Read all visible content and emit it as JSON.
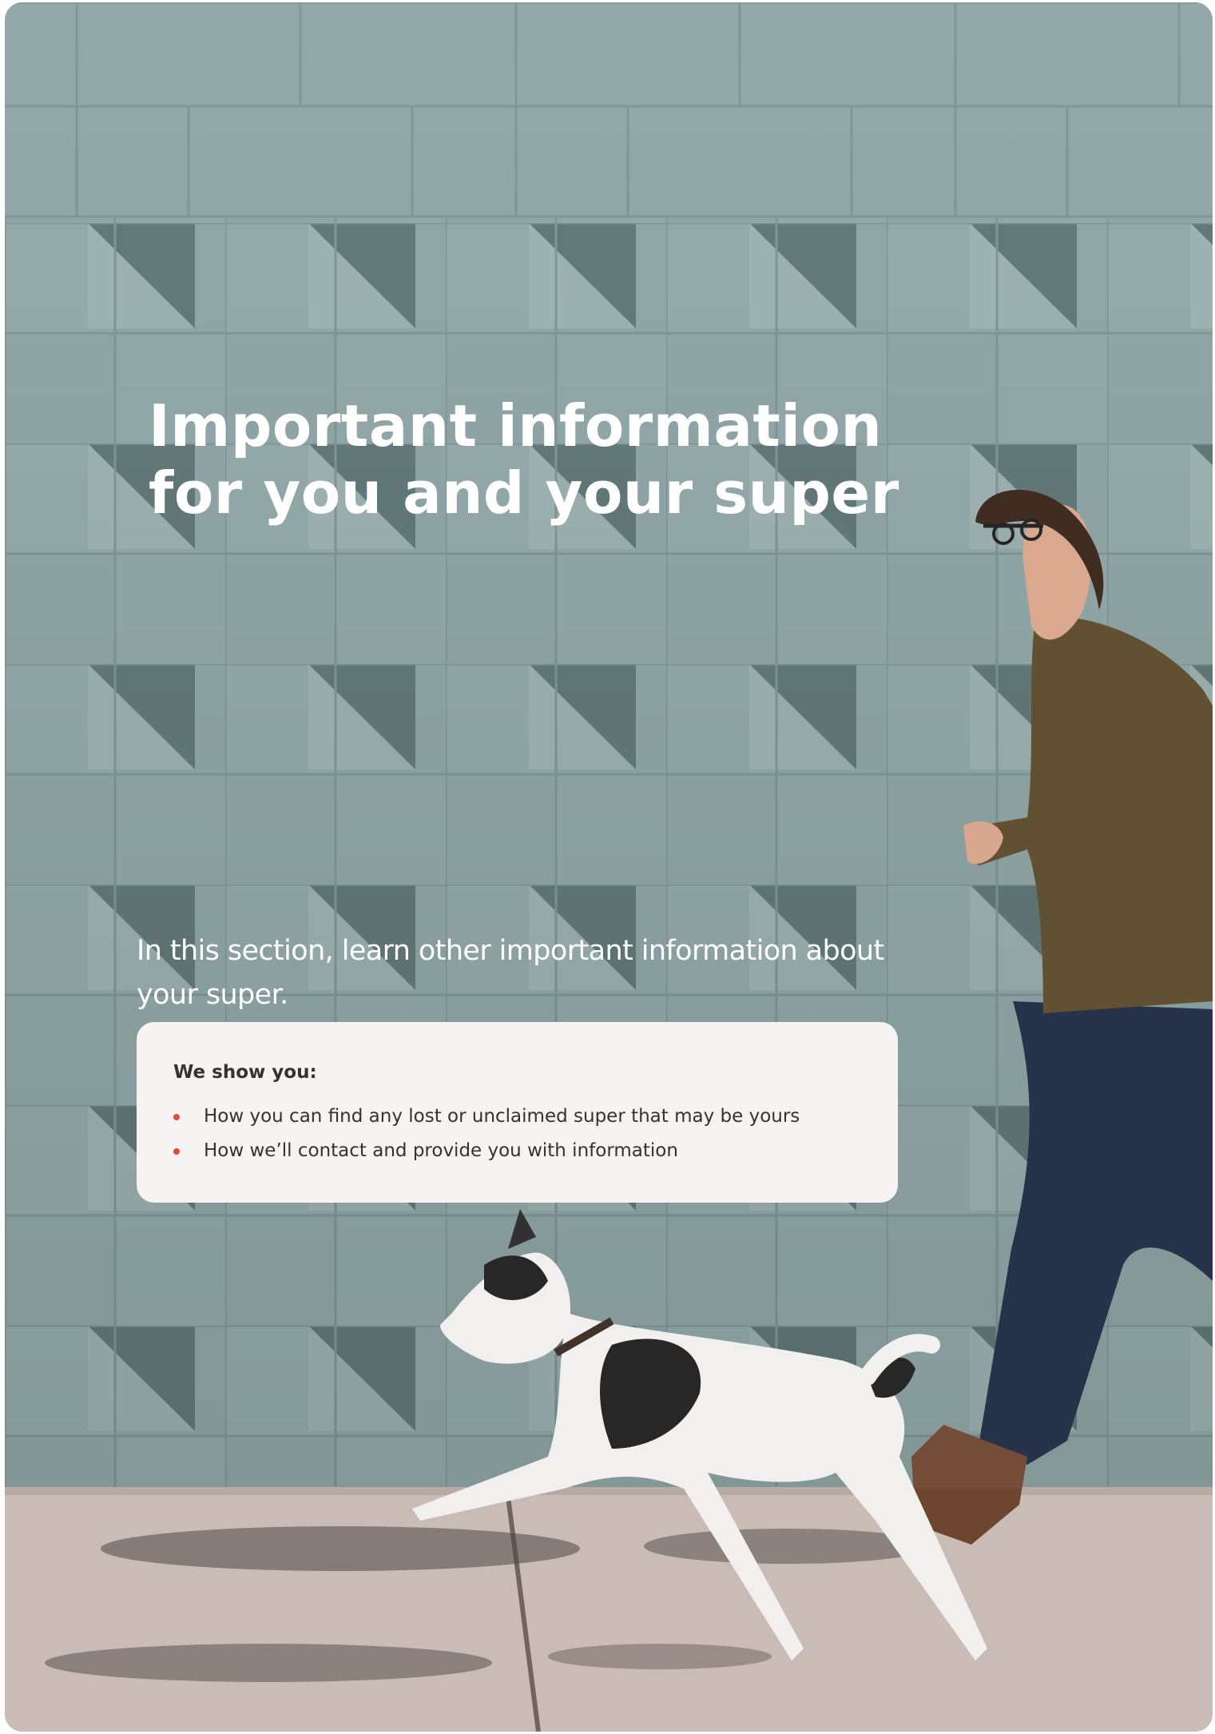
{
  "heading": {
    "line1": "Important information",
    "line2": "for you and your super"
  },
  "intro": "In this section, learn other important information about your super.",
  "card": {
    "heading": "We show you:",
    "items": [
      "How you can find any lost or unclaimed super that may be yours",
      "How we’ll contact and provide you with information"
    ]
  },
  "colors": {
    "wall": "#8fa6a6",
    "wall_dark": "#5f7676",
    "pavement": "#c9bcb6",
    "card_bg": "#f6f3f2",
    "bullet": "#e8483c",
    "text_dark": "#333333",
    "text_light": "#ffffff"
  }
}
